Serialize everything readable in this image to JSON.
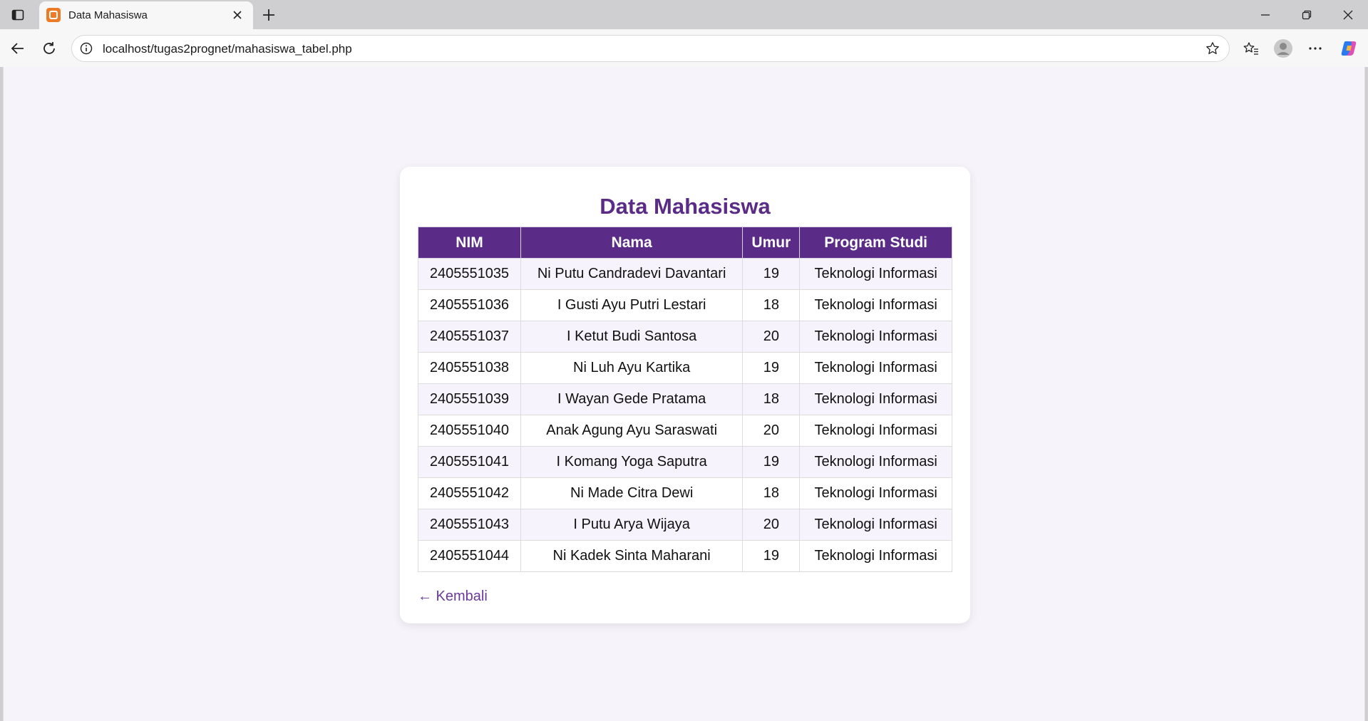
{
  "browser": {
    "tab": {
      "title": "Data Mahasiswa",
      "favicon": "xampp-favicon"
    },
    "address_bar": {
      "url": "localhost/tugas2prognet/mahasiswa_tabel.php"
    }
  },
  "page": {
    "title": "Data Mahasiswa",
    "table": {
      "headers": [
        "NIM",
        "Nama",
        "Umur",
        "Program Studi"
      ],
      "rows": [
        [
          "2405551035",
          "Ni Putu Candradevi Davantari",
          "19",
          "Teknologi Informasi"
        ],
        [
          "2405551036",
          "I Gusti Ayu Putri Lestari",
          "18",
          "Teknologi Informasi"
        ],
        [
          "2405551037",
          "I Ketut Budi Santosa",
          "20",
          "Teknologi Informasi"
        ],
        [
          "2405551038",
          "Ni Luh Ayu Kartika",
          "19",
          "Teknologi Informasi"
        ],
        [
          "2405551039",
          "I Wayan Gede Pratama",
          "18",
          "Teknologi Informasi"
        ],
        [
          "2405551040",
          "Anak Agung Ayu Saraswati",
          "20",
          "Teknologi Informasi"
        ],
        [
          "2405551041",
          "I Komang Yoga Saputra",
          "19",
          "Teknologi Informasi"
        ],
        [
          "2405551042",
          "Ni Made Citra Dewi",
          "18",
          "Teknologi Informasi"
        ],
        [
          "2405551043",
          "I Putu Arya Wijaya",
          "20",
          "Teknologi Informasi"
        ],
        [
          "2405551044",
          "Ni Kadek Sinta Maharani",
          "19",
          "Teknologi Informasi"
        ]
      ]
    },
    "back_link": "← Kembali"
  },
  "colors": {
    "accent": "#5a2c87",
    "link": "#6a3a9c",
    "page_background": "#f6f4fa",
    "row_stripe": "#f7f3fc"
  }
}
